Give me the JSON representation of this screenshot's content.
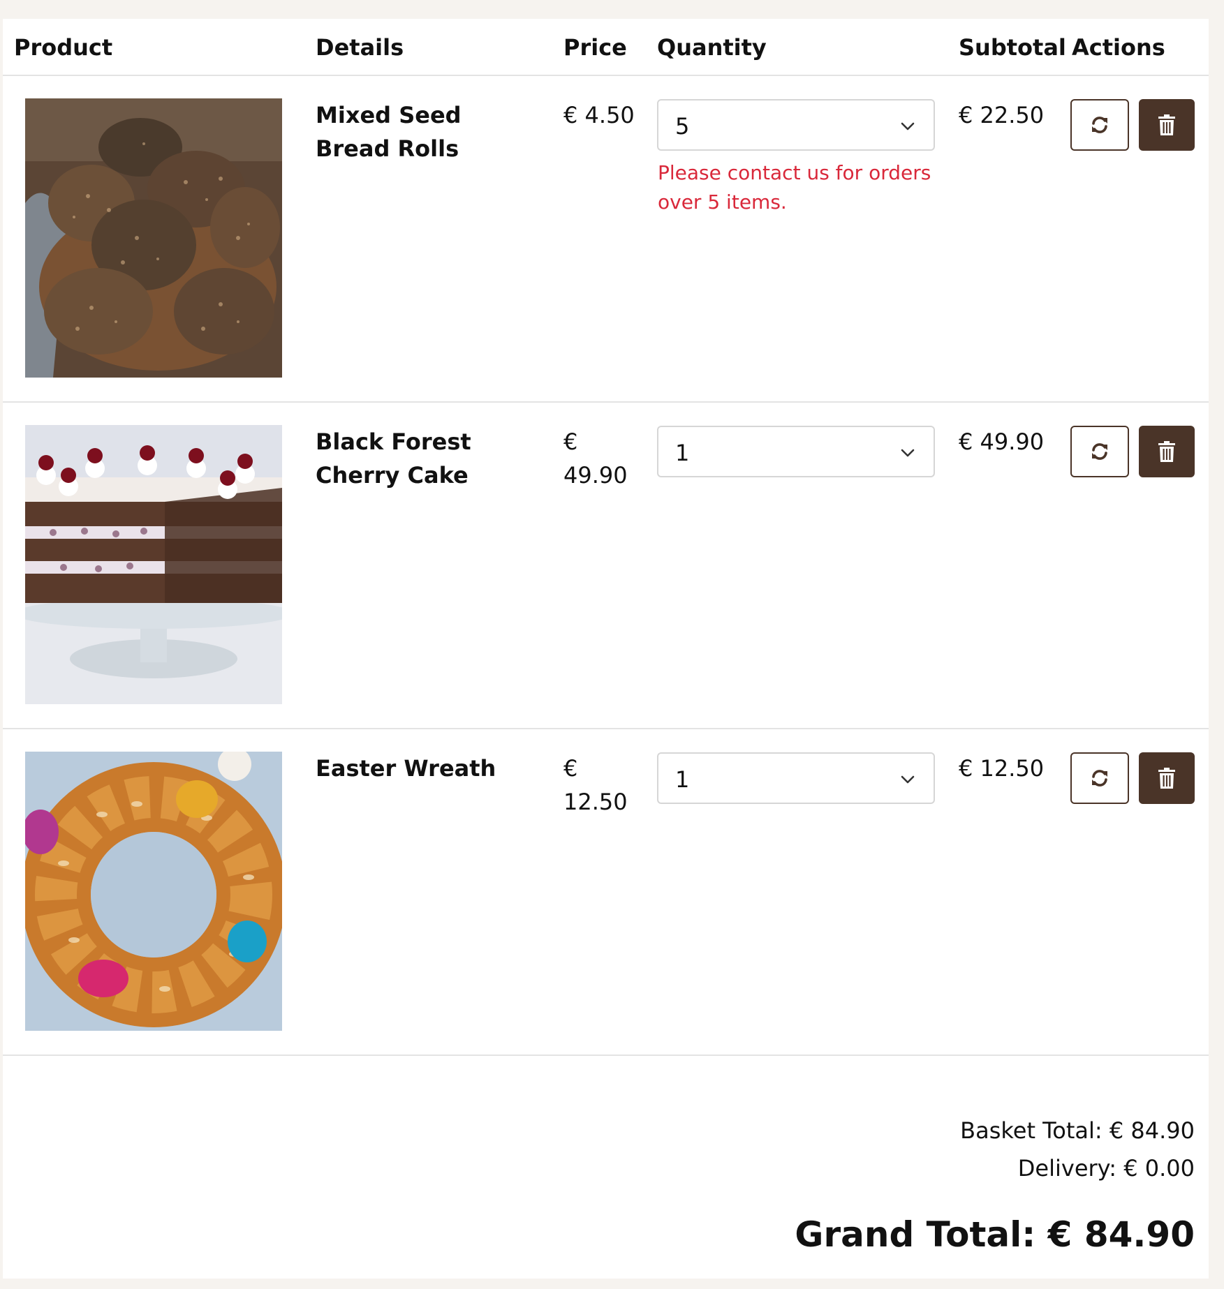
{
  "table": {
    "headers": {
      "product": "Product",
      "details": "Details",
      "price": "Price",
      "quantity": "Quantity",
      "subtotal": "Subtotal",
      "actions": "Actions"
    },
    "rows": [
      {
        "name": "Mixed Seed Bread Rolls",
        "price": "€ 4.50",
        "quantity": "5",
        "warning": "Please contact us for orders over 5 items.",
        "subtotal": "€ 22.50",
        "update_icon": "sync-icon",
        "delete_icon": "trash-icon"
      },
      {
        "name": "Black Forest Cherry Cake",
        "price": "€ 49.90",
        "quantity": "1",
        "warning": "",
        "subtotal": "€ 49.90",
        "update_icon": "sync-icon",
        "delete_icon": "trash-icon"
      },
      {
        "name": "Easter Wreath",
        "price": "€ 12.50",
        "quantity": "1",
        "warning": "",
        "subtotal": "€ 12.50",
        "update_icon": "sync-icon",
        "delete_icon": "trash-icon"
      }
    ]
  },
  "summary": {
    "basket_total": "Basket Total: € 84.90",
    "delivery": "Delivery: € 0.00",
    "grand_total": "Grand Total: € 84.90"
  },
  "colors": {
    "accent": "#4a3428",
    "warning": "#d9283a",
    "page_background": "#f6f3ef"
  }
}
